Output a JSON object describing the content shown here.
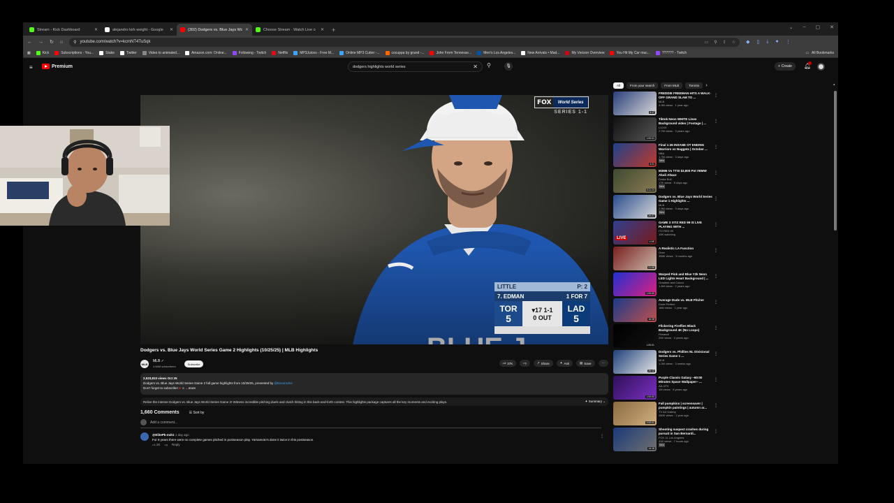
{
  "tabs": [
    {
      "title": "Stream - Kick Dashboard",
      "favicon": "kick-icon",
      "color": "#53fc18",
      "active": false
    },
    {
      "title": "alejandro kirk weight - Google",
      "favicon": "google-icon",
      "color": "#ffffff",
      "active": false
    },
    {
      "title": "(302) Dodgers vs. Blue Jays Wo",
      "favicon": "youtube-icon",
      "color": "#ff0000",
      "active": true
    },
    {
      "title": "Choose Stream · Watch Live o",
      "favicon": "kick-icon",
      "color": "#53fc18",
      "active": false
    }
  ],
  "address": {
    "url": "youtube.com/watch?v=kcmNT4TuSqk"
  },
  "bookmarks": [
    {
      "label": "Kick",
      "color": "#53fc18"
    },
    {
      "label": "Subscriptions - You...",
      "color": "#ff0000"
    },
    {
      "label": "Stake",
      "color": "#ffffff"
    },
    {
      "label": "Twitter",
      "color": "#ffffff"
    },
    {
      "label": "Video to animated...",
      "color": "#888888"
    },
    {
      "label": "Amazon.com: Online...",
      "color": "#ffffff"
    },
    {
      "label": "Following - Twitch",
      "color": "#9146ff"
    },
    {
      "label": "Netflix",
      "color": "#e50914"
    },
    {
      "label": "MP3Juices - Free M...",
      "color": "#3ea6ff"
    },
    {
      "label": "Online MP3 Cutter -...",
      "color": "#3ea6ff"
    },
    {
      "label": "cocuppa by grand -...",
      "color": "#ff6600"
    },
    {
      "label": "John From Tennesse...",
      "color": "#ff0000"
    },
    {
      "label": "Men's Los Angeles...",
      "color": "#0055aa"
    },
    {
      "label": "New Arrivals • Mad...",
      "color": "#ffffff"
    },
    {
      "label": "My Verizon Overview",
      "color": "#cd040b"
    },
    {
      "label": "You Hit My Car mac...",
      "color": "#ff0000"
    },
    {
      "label": "?????? - Twitch",
      "color": "#9146ff"
    }
  ],
  "bookmarks_all": "All Bookmarks",
  "youtube": {
    "brand": "Premium",
    "search_query": "dodgers highlights world series",
    "create_label": "Create"
  },
  "video": {
    "title": "Dodgers vs. Blue Jays World Series Game 2 Highlights (10/25/25) | MLB Highlights",
    "channel": "MLB",
    "subscribers": "4.84M subscribers",
    "subscribe_label": "Subscribe",
    "likes": "37K",
    "share_label": "Share",
    "ask_label": "Ask",
    "save_label": "Save",
    "views": "2,533,810 views  Oct 25",
    "desc_line1": "Dodgers vs. Blue Jays World Series Game 2 full game highlights from 10/25/25, presented by ",
    "desc_link": "@ExxonUSA",
    "desc_line2": "Don't forget to subscribe! ",
    "desc_more": "...more",
    "summary_text": "Relive the intense Dodgers vs. Blue Jays World Series Game 2! Witness incredible pitching duels and clutch hitting in this back-and-forth contest. This highlights package captures all the key moments and exciting plays.",
    "summary_label": "Summary"
  },
  "overlay": {
    "fox": "FOX",
    "ws": "World Series",
    "series": "SERIES 1-1",
    "pitcher": "LITTLE",
    "pitch_count": "P: 2",
    "batter": "7. EDMAN",
    "batter_stat": "1 FOR 7",
    "away_team": "TOR",
    "away_score": "5",
    "home_team": "LAD",
    "home_score": "5",
    "inning": "▾17 1-1",
    "outs": "0 OUT"
  },
  "comments": {
    "count": "1,660 Comments",
    "sort_label": "Sort by",
    "add_placeholder": "Add a comment...",
    "items": [
      {
        "author": "@ElitePk-mdrz",
        "time": "1 day ago",
        "text": "For 8 years there were no complete games pitched in postseason play. Yamamoto's done it twice in this postseason.",
        "likes": "2K",
        "reply": "Reply"
      }
    ]
  },
  "chips": [
    "All",
    "From your search",
    "From MLB",
    "Toronto"
  ],
  "recommendations": [
    {
      "title": "FREDDIE FREEMAN HITS A WALK-OFF GRAND SLAM TO ...",
      "channel": "MLB",
      "meta": "4.9M views · 1 year ago",
      "duration": "4:17",
      "colors": [
        "#2a3f7a",
        "#d9d9d9"
      ]
    },
    {
      "title": "Tiktok Neon WHITE Lines Background video | Footage | ...",
      "channel": "LUXIX",
      "meta": "2.7M views · 3 years ago",
      "duration": "1:00:01",
      "colors": [
        "#111111",
        "#555555"
      ]
    },
    {
      "title": "Final 1:36 INSANE OT ENDING Warriors vs Nuggets | October ...",
      "channel": "NBA",
      "meta": "1.7M views · 3 days ago",
      "duration": "4:21",
      "badge": "New",
      "colors": [
        "#1d428a",
        "#c0392b"
      ]
    },
    {
      "title": "M3M6 Vs TTSI $3,800 Pot #BMW Akuli Altace",
      "channel": "Drake Bull",
      "meta": "17K views · 5 days ago",
      "duration": "3:11:24",
      "badge": "New",
      "colors": [
        "#3e4a2f",
        "#8a7a55"
      ]
    },
    {
      "title": "Dodgers vs. Blue Jays World Series Game 1 Highlights ...",
      "channel": "MLB",
      "meta": "2.9M views · 3 days ago",
      "duration": "20:27",
      "badge": "New",
      "colors": [
        "#2a4d8f",
        "#d8d8d8"
      ]
    },
    {
      "title": "GAME 3 !!ITZ RED 99 IS LIVE PLAYING WITH ...",
      "channel": "ITZ RED 99",
      "meta": "10K watching",
      "duration": "LIVE",
      "live": true,
      "colors": [
        "#2f3f8f",
        "#7a1a1a"
      ]
    },
    {
      "title": "A Realistic LA Function",
      "channel": "Gree",
      "meta": "358K views · 3 months ago",
      "duration": "21:06",
      "colors": [
        "#7a2020",
        "#c9b8a8"
      ]
    },
    {
      "title": "Warped Pink and Blue Y2k Neon LED Lights Heart Background | ...",
      "channel": "Gradient and Colour",
      "meta": "1.4M views · 2 years ago",
      "duration": "1:00:00",
      "colors": [
        "#2030d0",
        "#e02080"
      ]
    },
    {
      "title": "Average Dude vs. MLB Pitcher",
      "channel": "Dude Perfect",
      "meta": "18M views · 1 year ago",
      "duration": "16:38",
      "colors": [
        "#1a3a8a",
        "#c0504d"
      ]
    },
    {
      "title": "Flickering Fireflies Black Background 4K (No Loops)",
      "channel": "Fireandi",
      "meta": "24K views · 3 years ago",
      "duration": "1:00:01",
      "colors": [
        "#000000",
        "#101010"
      ]
    },
    {
      "title": "Dodgers vs. Phillies NL Divisional Series Game 1 ...",
      "channel": "MLB",
      "meta": "1.2M views · 3 weeks ago",
      "duration": "20:12",
      "colors": [
        "#1d3f7a",
        "#e8e8e8"
      ]
    },
    {
      "title": "Purple Classic Galaxy ~60:00 Minutes Space Wallpaper~ ...",
      "channel": "AA-VFX",
      "meta": "1M views · 8 years ago",
      "duration": "1:00:00",
      "colors": [
        "#30105a",
        "#7a30c0"
      ]
    },
    {
      "title": "Fall pumpkins | screensaver | pumpkin paintings | autumn ar...",
      "channel": "TV Art Gallery",
      "meta": "280K views · 1 year ago",
      "duration": "3:00:01",
      "colors": [
        "#8a6a40",
        "#d0b080"
      ]
    },
    {
      "title": "Shooting suspect crashes during pursuit in San Bernardi...",
      "channel": "FOX 11 Los Angeles",
      "meta": "41K views · 7 hours ago",
      "duration": "14:16",
      "badge": "New",
      "colors": [
        "#1a3a7a",
        "#707070"
      ]
    }
  ]
}
